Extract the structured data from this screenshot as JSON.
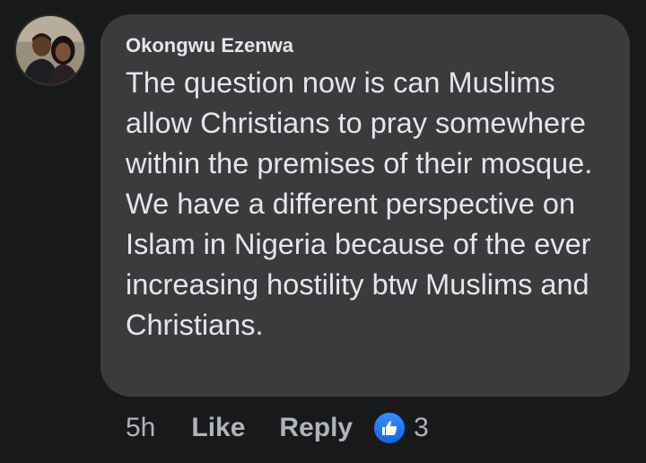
{
  "comment": {
    "author": "Okongwu Ezenwa",
    "text": "The question now is can Muslims allow Christians to pray somewhere within the premises of their mosque. We have a different perspective on Islam in Nigeria because of the ever increasing hostility btw Muslims and Christians.",
    "avatar_icon": "profile-photo-couple"
  },
  "actions": {
    "timestamp": "5h",
    "like_label": "Like",
    "reply_label": "Reply",
    "reaction_icon": "thumbs-up-icon",
    "reaction_count": "3"
  },
  "colors": {
    "background": "#18191a",
    "bubble": "#3a3b3c",
    "primary_text": "#e4e6eb",
    "secondary_text": "#b0b3b8",
    "like_blue": "#1877f2"
  }
}
